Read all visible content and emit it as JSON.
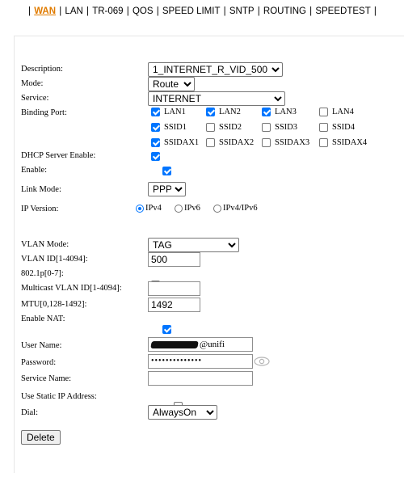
{
  "nav": {
    "items": [
      {
        "label": "WAN",
        "active": true
      },
      {
        "label": "LAN",
        "active": false
      },
      {
        "label": "TR-069",
        "active": false
      },
      {
        "label": "QOS",
        "active": false
      },
      {
        "label": "SPEED LIMIT",
        "active": false
      },
      {
        "label": "SNTP",
        "active": false
      },
      {
        "label": "ROUTING",
        "active": false
      },
      {
        "label": "SPEEDTEST",
        "active": false
      }
    ],
    "separator": "|"
  },
  "form": {
    "description": {
      "label": "Description:",
      "value": "1_INTERNET_R_VID_500"
    },
    "mode": {
      "label": "Mode:",
      "value": "Route"
    },
    "service": {
      "label": "Service:",
      "value": "INTERNET"
    },
    "binding": {
      "label": "Binding Port:",
      "ports": [
        {
          "name": "LAN1",
          "checked": true
        },
        {
          "name": "LAN2",
          "checked": true
        },
        {
          "name": "LAN3",
          "checked": true
        },
        {
          "name": "LAN4",
          "checked": false
        },
        {
          "name": "SSID1",
          "checked": true
        },
        {
          "name": "SSID2",
          "checked": false
        },
        {
          "name": "SSID3",
          "checked": false
        },
        {
          "name": "SSID4",
          "checked": false
        },
        {
          "name": "SSIDAX1",
          "checked": true
        },
        {
          "name": "SSIDAX2",
          "checked": false
        },
        {
          "name": "SSIDAX3",
          "checked": false
        },
        {
          "name": "SSIDAX4",
          "checked": false
        }
      ]
    },
    "dhcp_server": {
      "label": "DHCP Server Enable:",
      "checked": true
    },
    "enable": {
      "label": "Enable:",
      "checked": true
    },
    "link_mode": {
      "label": "Link Mode:",
      "value": "PPP"
    },
    "ip_version": {
      "label": "IP Version:",
      "options": [
        {
          "name": "IPv4",
          "selected": true
        },
        {
          "name": "IPv6",
          "selected": false
        },
        {
          "name": "IPv4/IPv6",
          "selected": false
        }
      ]
    },
    "vlan_mode": {
      "label": "VLAN Mode:",
      "value": "TAG"
    },
    "vlan_id": {
      "label": "VLAN ID[1-4094]:",
      "value": "500"
    },
    "dot1p": {
      "label": "802.1p[0-7]:",
      "checked": false
    },
    "multicast_vlan": {
      "label": "Multicast VLAN ID[1-4094]:",
      "value": ""
    },
    "mtu": {
      "label": "MTU[0,128-1492]:",
      "value": "1492"
    },
    "enable_nat": {
      "label": "Enable NAT:",
      "checked": true
    },
    "user_name": {
      "label": "User Name:",
      "suffix": "@unifi"
    },
    "password": {
      "label": "Password:",
      "masked": "••••••••••••••"
    },
    "service_name": {
      "label": "Service Name:",
      "value": ""
    },
    "static_ip": {
      "label": "Use Static IP Address:",
      "checked": false
    },
    "dial": {
      "label": "Dial:",
      "value": "AlwaysOn"
    },
    "delete_button": "Delete"
  },
  "colors": {
    "accent": "#0075ff",
    "nav_active": "#e07b00"
  }
}
